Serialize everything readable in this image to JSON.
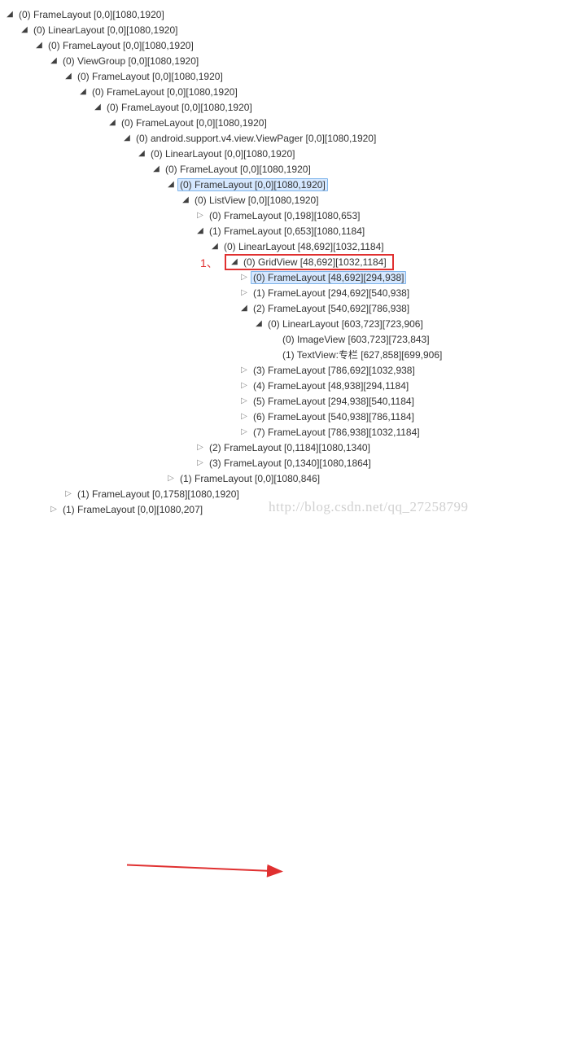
{
  "glyphs": {
    "expanded": "◢",
    "collapsed": "▷"
  },
  "annotation": {
    "label": "1、"
  },
  "watermark": "http://blog.csdn.net/qq_27258799",
  "tree": [
    {
      "depth": 0,
      "state": "expanded",
      "text": "(0) FrameLayout [0,0][1080,1920]"
    },
    {
      "depth": 1,
      "state": "expanded",
      "text": "(0) LinearLayout [0,0][1080,1920]"
    },
    {
      "depth": 2,
      "state": "expanded",
      "text": "(0) FrameLayout [0,0][1080,1920]"
    },
    {
      "depth": 3,
      "state": "expanded",
      "text": "(0) ViewGroup [0,0][1080,1920]"
    },
    {
      "depth": 4,
      "state": "expanded",
      "text": "(0) FrameLayout [0,0][1080,1920]"
    },
    {
      "depth": 5,
      "state": "expanded",
      "text": "(0) FrameLayout [0,0][1080,1920]"
    },
    {
      "depth": 6,
      "state": "expanded",
      "text": "(0) FrameLayout [0,0][1080,1920]"
    },
    {
      "depth": 7,
      "state": "expanded",
      "text": "(0) FrameLayout [0,0][1080,1920]"
    },
    {
      "depth": 8,
      "state": "expanded",
      "text": "(0) android.support.v4.view.ViewPager [0,0][1080,1920]"
    },
    {
      "depth": 9,
      "state": "expanded",
      "text": "(0) LinearLayout [0,0][1080,1920]"
    },
    {
      "depth": 10,
      "state": "expanded",
      "text": "(0) FrameLayout [0,0][1080,1920]"
    },
    {
      "depth": 11,
      "state": "expanded",
      "text": "(0) FrameLayout [0,0][1080,1920]",
      "selected": true
    },
    {
      "depth": 12,
      "state": "expanded",
      "text": "(0) ListView [0,0][1080,1920]"
    },
    {
      "depth": 13,
      "state": "collapsed",
      "text": "(0) FrameLayout [0,198][1080,653]"
    },
    {
      "depth": 13,
      "state": "expanded",
      "text": "(1) FrameLayout [0,653][1080,1184]"
    },
    {
      "depth": 14,
      "state": "expanded",
      "text": "(0) LinearLayout [48,692][1032,1184]"
    },
    {
      "depth": 15,
      "state": "expanded",
      "text": "(0) GridView [48,692][1032,1184]",
      "highlight": true
    },
    {
      "depth": 16,
      "state": "collapsed",
      "text": "(0) FrameLayout [48,692][294,938]",
      "selected": true
    },
    {
      "depth": 16,
      "state": "collapsed",
      "text": "(1) FrameLayout [294,692][540,938]"
    },
    {
      "depth": 16,
      "state": "expanded",
      "text": "(2) FrameLayout [540,692][786,938]"
    },
    {
      "depth": 17,
      "state": "expanded",
      "text": "(0) LinearLayout [603,723][723,906]"
    },
    {
      "depth": 18,
      "state": "leaf",
      "text": "(0) ImageView [603,723][723,843]"
    },
    {
      "depth": 18,
      "state": "leaf",
      "text": "(1) TextView:专栏 [627,858][699,906]",
      "arrowTarget": true
    },
    {
      "depth": 16,
      "state": "collapsed",
      "text": "(3) FrameLayout [786,692][1032,938]"
    },
    {
      "depth": 16,
      "state": "collapsed",
      "text": "(4) FrameLayout [48,938][294,1184]"
    },
    {
      "depth": 16,
      "state": "collapsed",
      "text": "(5) FrameLayout [294,938][540,1184]"
    },
    {
      "depth": 16,
      "state": "collapsed",
      "text": "(6) FrameLayout [540,938][786,1184]"
    },
    {
      "depth": 16,
      "state": "collapsed",
      "text": "(7) FrameLayout [786,938][1032,1184]"
    },
    {
      "depth": 13,
      "state": "collapsed",
      "text": "(2) FrameLayout [0,1184][1080,1340]"
    },
    {
      "depth": 13,
      "state": "collapsed",
      "text": "(3) FrameLayout [0,1340][1080,1864]"
    },
    {
      "depth": 11,
      "state": "collapsed",
      "text": "(1) FrameLayout [0,0][1080,846]"
    },
    {
      "depth": 4,
      "state": "collapsed",
      "text": "(1) FrameLayout [0,1758][1080,1920]"
    },
    {
      "depth": 3,
      "state": "collapsed",
      "text": "(1) FrameLayout [0,0][1080,207]"
    }
  ]
}
